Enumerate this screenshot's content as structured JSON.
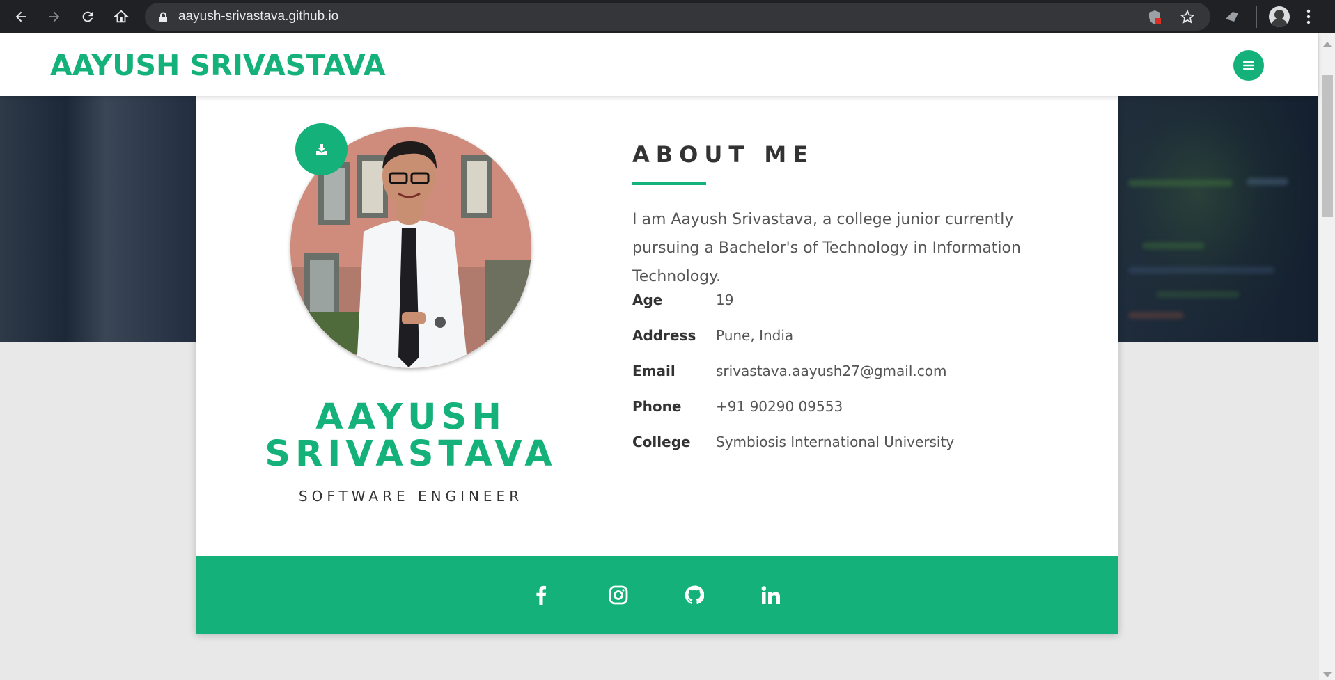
{
  "browser": {
    "url": "aayush-srivastava.github.io"
  },
  "navbar": {
    "brand": "AAYUSH SRIVASTAVA"
  },
  "profile": {
    "name_line1": "AAYUSH",
    "name_line2": "SRIVASTAVA",
    "title": "SOFTWARE ENGINEER"
  },
  "about": {
    "heading": "ABOUT ME",
    "text": "I am Aayush Srivastava, a college junior currently pursuing a Bachelor's of Technology in Information Technology.",
    "info": [
      {
        "label": "Age",
        "value": "19"
      },
      {
        "label": "Address",
        "value": "Pune, India"
      },
      {
        "label": "Email",
        "value": "srivastava.aayush27@gmail.com"
      },
      {
        "label": "Phone",
        "value": "+91 90290 09553"
      },
      {
        "label": "College",
        "value": "Symbiosis International University"
      }
    ]
  },
  "social": [
    "facebook-icon",
    "instagram-icon",
    "github-icon",
    "linkedin-icon"
  ],
  "colors": {
    "accent": "#14b17a",
    "chrome": "#202124",
    "hero": "#1d2a3b"
  }
}
